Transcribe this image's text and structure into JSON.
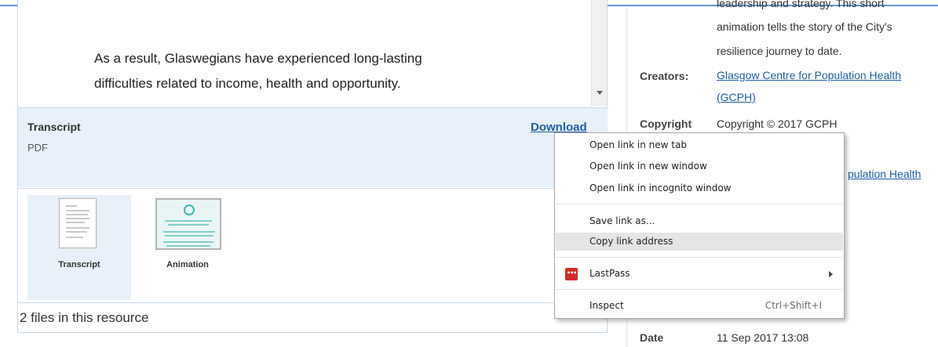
{
  "preview": {
    "line1": "As a result, Glaswegians have experienced long-lasting",
    "line2": "difficulties related to income, health and opportunity."
  },
  "transcript": {
    "title": "Transcript",
    "format": "PDF",
    "download_label": "Download"
  },
  "files": [
    {
      "label": "Transcript",
      "selected": true
    },
    {
      "label": "Animation",
      "selected": false
    }
  ],
  "files_count": "2 files in this resource",
  "metadata": {
    "description_lines": [
      "leadership and strategy. This short",
      "animation tells the story of the City's",
      "resilience journey to date."
    ],
    "creators_label": "Creators:",
    "creators_link_line1": "Glasgow Centre for Population Health",
    "creators_link_line2": "(GCPH)",
    "copyright_label": "Copyright",
    "copyright_value": "Copyright © 2017 GCPH",
    "owner_link_fragment": "pulation Health",
    "date_label": "Date",
    "date_value": "11 Sep 2017 13:08"
  },
  "context_menu": {
    "items": [
      {
        "label": "Open link in new tab"
      },
      {
        "label": "Open link in new window"
      },
      {
        "label": "Open link in incognito window"
      },
      {
        "label": "Save link as..."
      },
      {
        "label": "Copy link address",
        "hover": true
      },
      {
        "label": "LastPass",
        "icon": "lastpass-icon",
        "icon_text": "•••",
        "submenu": true
      },
      {
        "label": "Inspect",
        "shortcut": "Ctrl+Shift+I"
      }
    ]
  },
  "colors": {
    "accent_blue": "#5b9bd5",
    "link_blue": "#1f5fa8",
    "panel_tint": "#e8f1f9",
    "lastpass_red": "#d32d27"
  }
}
